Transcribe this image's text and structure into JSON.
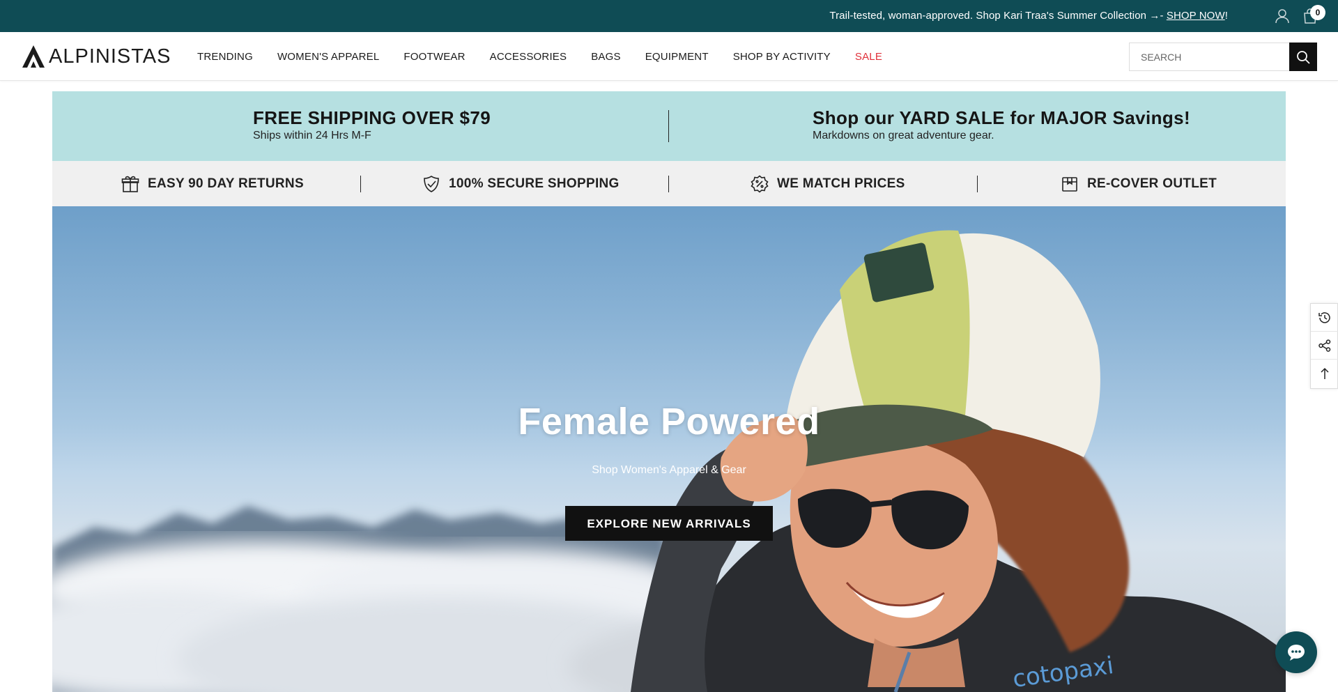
{
  "announcement": {
    "text": "Trail-tested, woman-approved. Shop Kari Traa's Summer Collection →- ",
    "link": "SHOP NOW",
    "suffix": "!",
    "account_icon": "user-icon",
    "cart_icon": "bag-icon",
    "cart_count": "0"
  },
  "header": {
    "logo_text": "ALPINISTAS",
    "nav": [
      "TRENDING",
      "WOMEN'S APPAREL",
      "FOOTWEAR",
      "ACCESSORIES",
      "BAGS",
      "EQUIPMENT",
      "SHOP BY ACTIVITY",
      "SALE"
    ],
    "search_placeholder": "SEARCH",
    "sale_color": "#e0303a"
  },
  "promo": {
    "left_title": "FREE SHIPPING OVER $79",
    "left_sub": "Ships within 24 Hrs M-F",
    "right_title": "Shop our YARD SALE for MAJOR Savings!",
    "right_sub": "Markdowns on great adventure gear.",
    "bg_color": "#b6e0e1"
  },
  "features": [
    {
      "label": "EASY 90 DAY RETURNS",
      "icon": "gift-icon"
    },
    {
      "label": "100% SECURE SHOPPING",
      "icon": "shield-check-icon"
    },
    {
      "label": "WE MATCH PRICES",
      "icon": "percent-badge-icon"
    },
    {
      "label": "RE-COVER OUTLET",
      "icon": "box-icon"
    }
  ],
  "hero": {
    "title": "Female Powered",
    "subtitle": "Shop Women's Apparel & Gear",
    "button": "EXPLORE NEW ARRIVALS",
    "brand_on_jacket": "cotopaxi"
  },
  "side_tools": [
    "history-icon",
    "share-icon",
    "arrow-up-icon"
  ],
  "chat_icon": "chat-icon",
  "brand_color": "#0f4c55"
}
